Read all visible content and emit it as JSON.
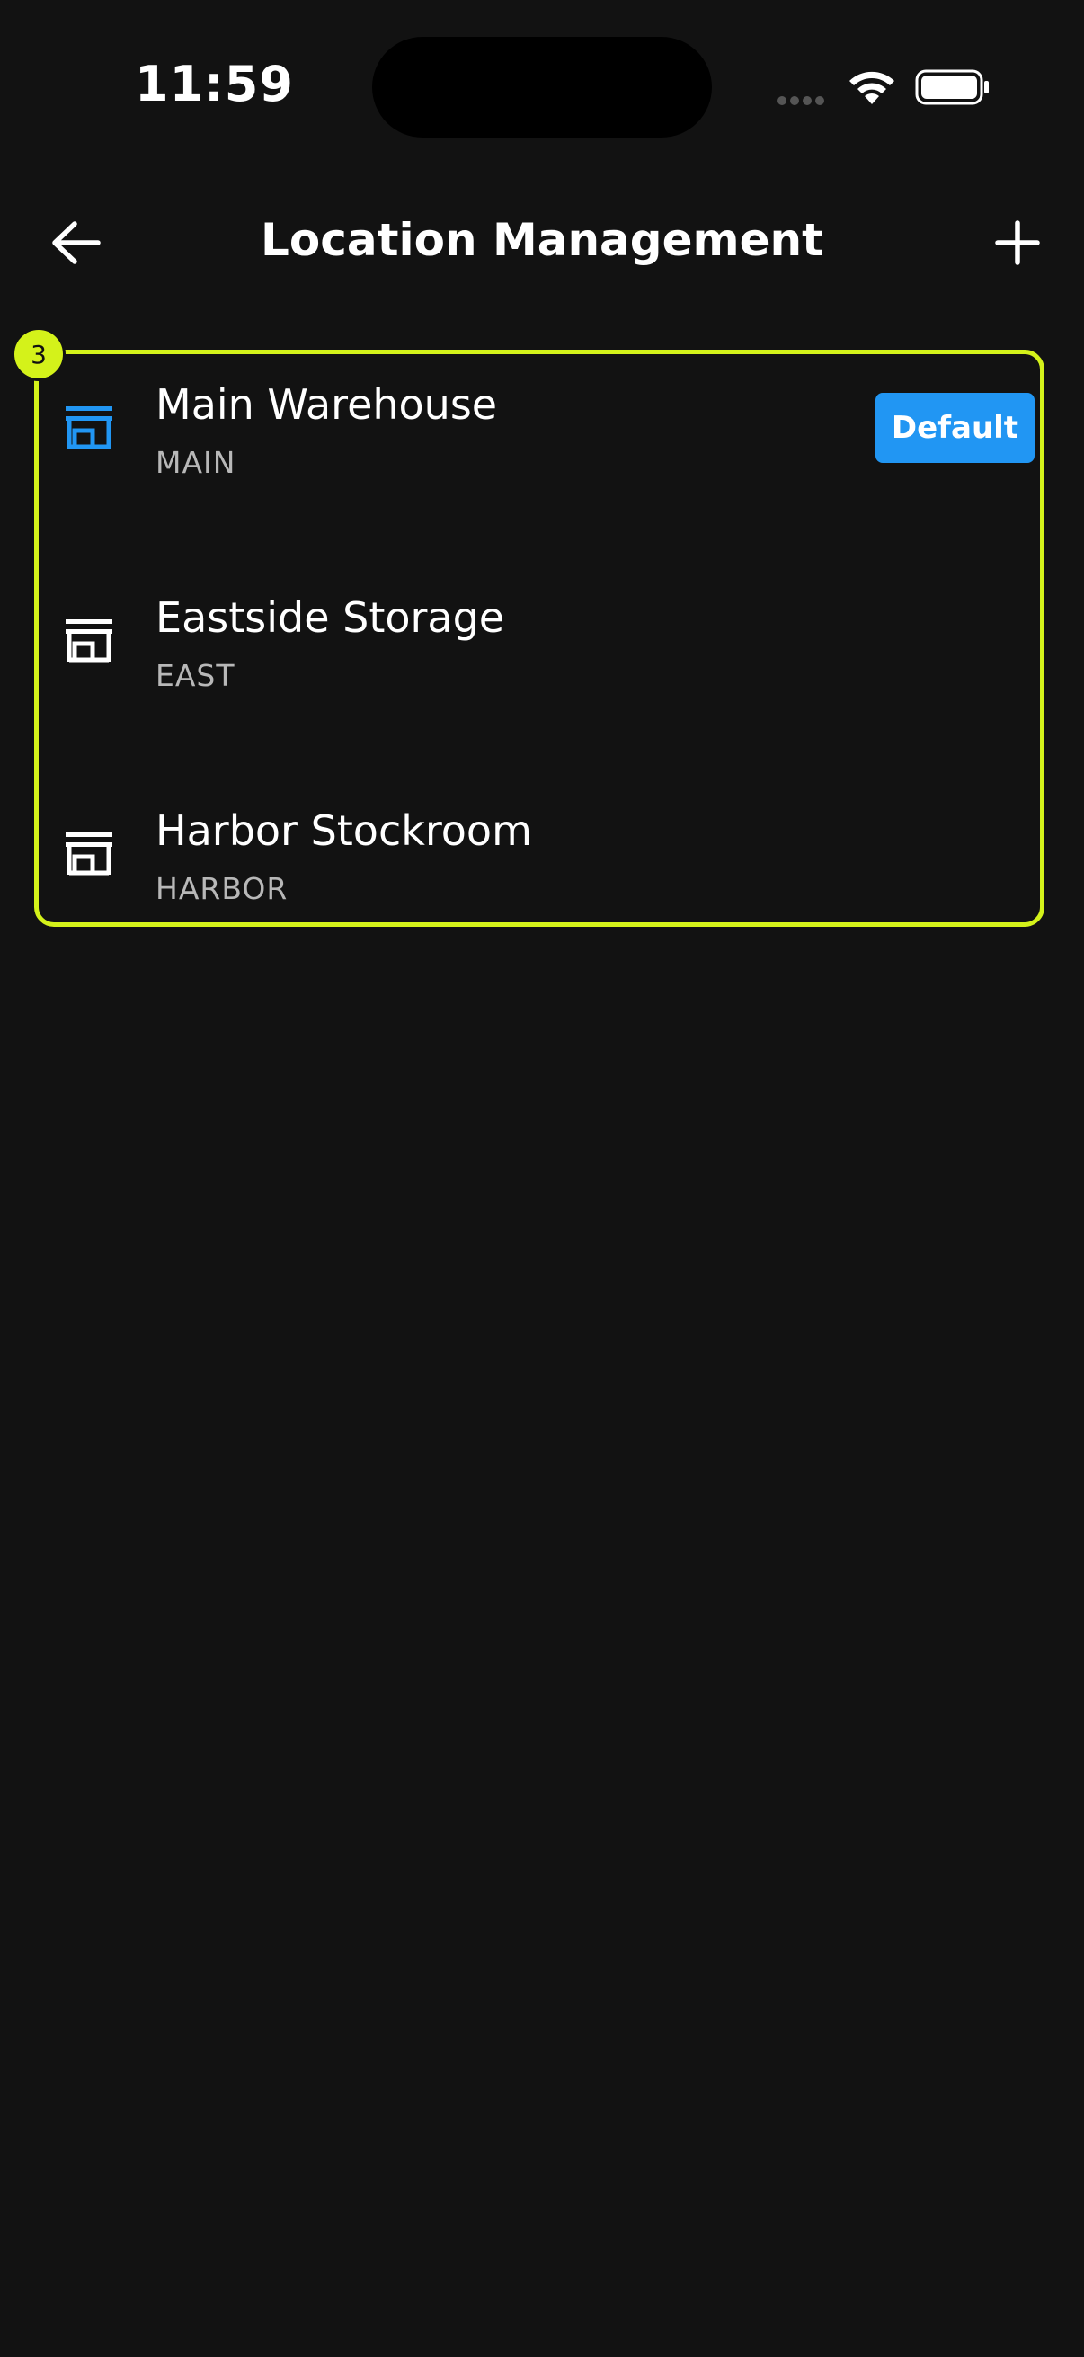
{
  "status_bar": {
    "time": "11:59"
  },
  "app_bar": {
    "title": "Location Management",
    "back_icon": "arrow-left-icon",
    "add_icon": "plus-icon"
  },
  "location_list": {
    "badge_count": "3",
    "highlight_color": "#d4f21a",
    "items": [
      {
        "name": "Main Warehouse",
        "code": "MAIN",
        "is_default": true,
        "icon": "store-icon",
        "icon_color": "#2196f3"
      },
      {
        "name": "Eastside Storage",
        "code": "EAST",
        "is_default": false,
        "icon": "store-icon",
        "icon_color": "#ffffff"
      },
      {
        "name": "Harbor Stockroom",
        "code": "HARBOR",
        "is_default": false,
        "icon": "store-icon",
        "icon_color": "#ffffff"
      }
    ],
    "default_label": "Default",
    "default_color": "#2196f3"
  }
}
